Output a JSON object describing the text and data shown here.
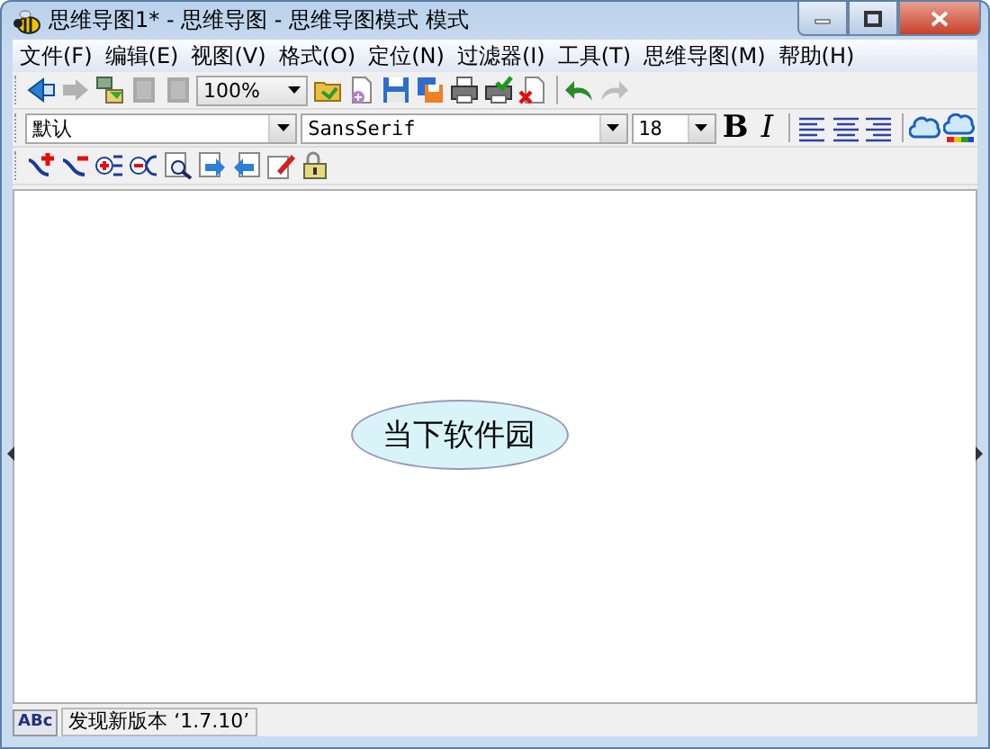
{
  "window": {
    "title": "思维导图1* - 思维导图 - 思维导图模式 模式"
  },
  "menu": [
    "文件(F)",
    "编辑(E)",
    "视图(V)",
    "格式(O)",
    "定位(N)",
    "过滤器(I)",
    "工具(T)",
    "思维导图(M)",
    "帮助(H)"
  ],
  "toolbar": {
    "left": [
      {
        "kind": "back",
        "disabled": false
      },
      {
        "kind": "forward",
        "disabled": true
      },
      {
        "kind": "network",
        "disabled": false
      },
      {
        "kind": "block",
        "disabled": true
      },
      {
        "kind": "block",
        "disabled": true
      }
    ],
    "zoom": "100%",
    "right": [
      {
        "kind": "open",
        "disabled": false
      },
      {
        "kind": "new",
        "disabled": false
      },
      {
        "kind": "save",
        "disabled": false
      },
      {
        "kind": "saveas",
        "disabled": false
      },
      {
        "kind": "print",
        "disabled": false
      },
      {
        "kind": "printcheck",
        "disabled": false
      },
      {
        "kind": "close",
        "disabled": false
      },
      {
        "kind": "sep"
      },
      {
        "kind": "undo",
        "disabled": false
      },
      {
        "kind": "redo",
        "disabled": true
      }
    ]
  },
  "format_bar": {
    "style": "默认",
    "font": "SansSerif",
    "size": "18",
    "bold": "B",
    "italic": "I"
  },
  "node_bar": [
    {
      "kind": "addnode"
    },
    {
      "kind": "removenode"
    },
    {
      "kind": "expand"
    },
    {
      "kind": "collapse"
    },
    {
      "kind": "find"
    },
    {
      "kind": "next"
    },
    {
      "kind": "prev"
    },
    {
      "kind": "edit"
    },
    {
      "kind": "lock"
    }
  ],
  "canvas": {
    "root_node": "当下软件园"
  },
  "status_bar": {
    "abc": "ABc",
    "message": "发现新版本 ‘1.7.10’"
  }
}
